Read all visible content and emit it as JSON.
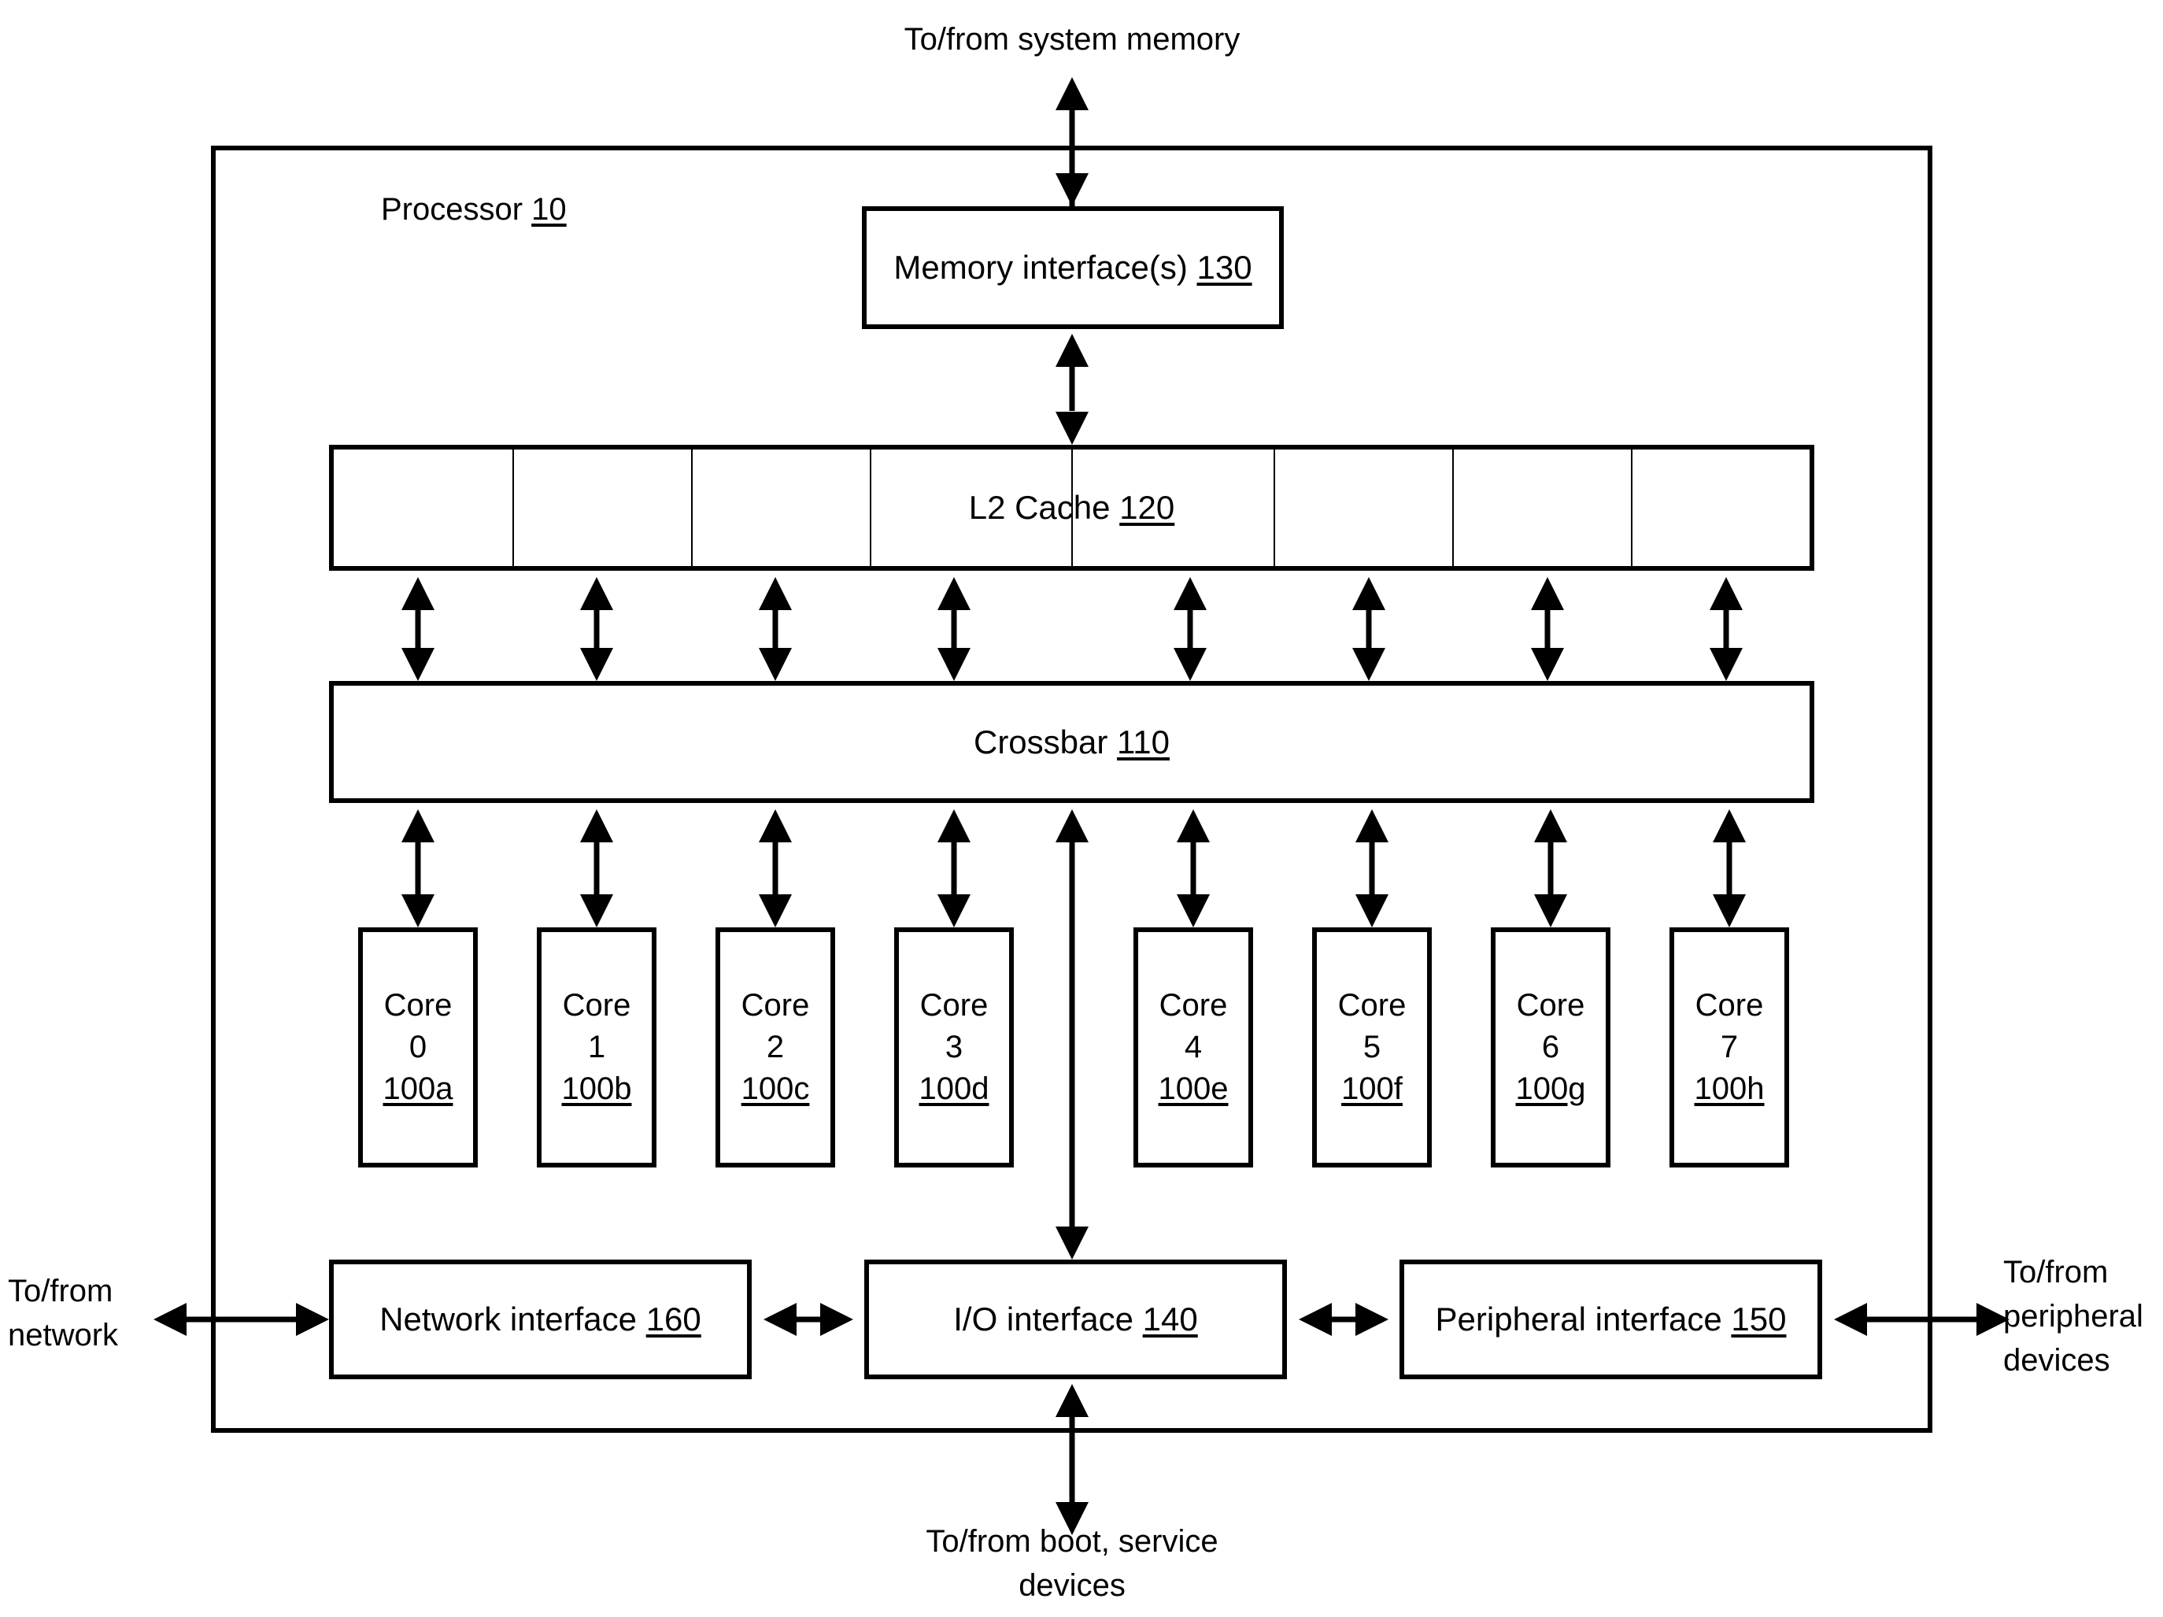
{
  "figure": {
    "kind": "patent-block-diagram",
    "ink_color": "#000000",
    "background_color": "#ffffff"
  },
  "processor": {
    "label_text": "Processor ",
    "label_ref": "10"
  },
  "external_labels": {
    "top": "To/from system memory",
    "left": "To/from\nnetwork",
    "right": "To/from\nperipheral\ndevices",
    "bottom": "To/from boot, service\ndevices"
  },
  "blocks": {
    "memory_interface": {
      "text": "Memory interface(s) ",
      "ref": "130"
    },
    "l2_cache": {
      "text": "L2 Cache ",
      "ref": "120",
      "banks": 8
    },
    "crossbar": {
      "text": "Crossbar ",
      "ref": "110"
    },
    "network_interface": {
      "text": "Network interface ",
      "ref": "160"
    },
    "io_interface": {
      "text": "I/O interface ",
      "ref": "140"
    },
    "peripheral_interface": {
      "text": "Peripheral interface ",
      "ref": "150"
    }
  },
  "cores": [
    {
      "name": "Core",
      "index": "0",
      "ref": "100a"
    },
    {
      "name": "Core",
      "index": "1",
      "ref": "100b"
    },
    {
      "name": "Core",
      "index": "2",
      "ref": "100c"
    },
    {
      "name": "Core",
      "index": "3",
      "ref": "100d"
    },
    {
      "name": "Core",
      "index": "4",
      "ref": "100e"
    },
    {
      "name": "Core",
      "index": "5",
      "ref": "100f"
    },
    {
      "name": "Core",
      "index": "6",
      "ref": "100g"
    },
    {
      "name": "Core",
      "index": "7",
      "ref": "100h"
    }
  ],
  "connections": [
    {
      "from": "system-memory",
      "to": "memory_interface",
      "style": "double-arrow-vertical"
    },
    {
      "from": "memory_interface",
      "to": "l2_cache",
      "style": "double-arrow-vertical"
    },
    {
      "from": "l2_cache",
      "to": "crossbar",
      "style": "double-arrow-vertical",
      "count": 8
    },
    {
      "from": "crossbar",
      "to": "cores",
      "style": "double-arrow-vertical",
      "count": 8
    },
    {
      "from": "crossbar",
      "to": "io_interface",
      "style": "double-arrow-vertical"
    },
    {
      "from": "network",
      "to": "network_interface",
      "style": "double-arrow-horizontal"
    },
    {
      "from": "network_interface",
      "to": "io_interface",
      "style": "double-arrow-horizontal"
    },
    {
      "from": "io_interface",
      "to": "peripheral_interface",
      "style": "double-arrow-horizontal"
    },
    {
      "from": "peripheral_interface",
      "to": "peripheral-devices",
      "style": "double-arrow-horizontal"
    },
    {
      "from": "io_interface",
      "to": "boot-service-devices",
      "style": "double-arrow-vertical"
    }
  ]
}
